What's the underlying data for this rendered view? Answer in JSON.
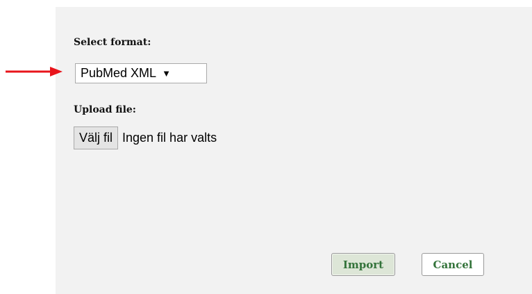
{
  "colors": {
    "panel_background": "#f2f2f2",
    "annotation_arrow": "#e8141b",
    "button_text_green": "#33733a"
  },
  "format": {
    "label": "Select format:",
    "selected": "PubMed XML",
    "caret": "▼"
  },
  "upload": {
    "label": "Upload file:",
    "button_label": "Välj fil",
    "status": "Ingen fil har valts"
  },
  "actions": {
    "import_label": "Import",
    "cancel_label": "Cancel"
  },
  "icons": {
    "annotation": "red-arrow-right-icon",
    "dropdown": "triangle-down-icon"
  }
}
